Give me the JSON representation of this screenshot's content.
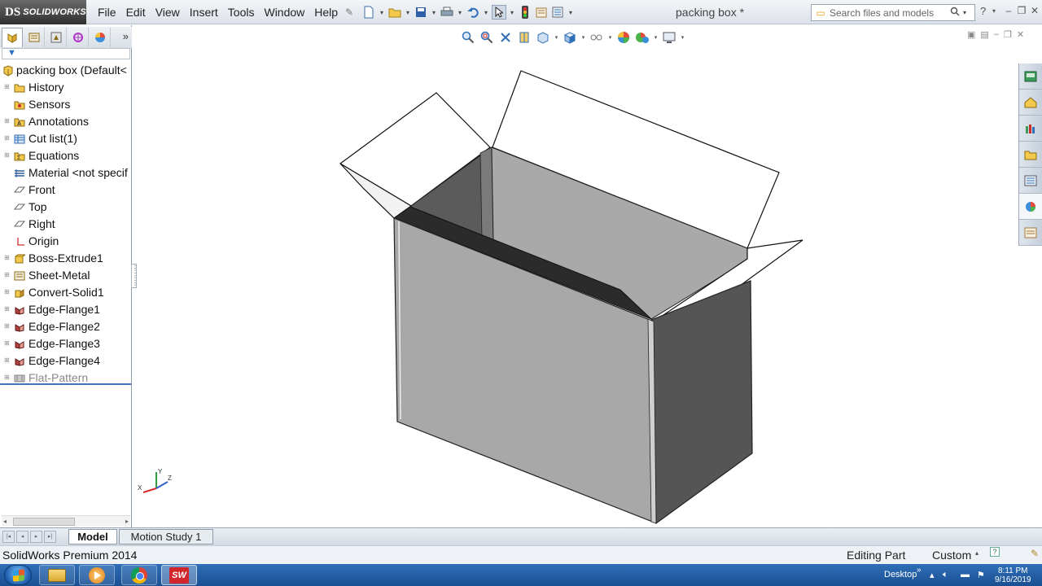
{
  "app": {
    "brand_mark": "DS",
    "brand_name": "SOLIDWORKS",
    "document_title": "packing box *",
    "menus": [
      {
        "label": "File"
      },
      {
        "label": "Edit"
      },
      {
        "label": "View"
      },
      {
        "label": "Insert"
      },
      {
        "label": "Tools"
      },
      {
        "label": "Window"
      },
      {
        "label": "Help"
      }
    ],
    "search": {
      "placeholder": "Search files and models",
      "value": ""
    },
    "colors": {
      "brand_bar": "#3a3a3a",
      "accent": "#3a78c2",
      "taskbar": "#1f5aa3",
      "solidworks_red": "#d2262c"
    }
  },
  "quick_access": [
    {
      "icon": "new-document-icon"
    },
    {
      "icon": "open-folder-icon"
    },
    {
      "icon": "save-icon"
    },
    {
      "icon": "print-icon"
    },
    {
      "icon": "undo-icon"
    },
    {
      "icon": "select-arrow-icon"
    },
    {
      "icon": "rebuild-traffic-light-icon"
    },
    {
      "icon": "file-properties-icon"
    },
    {
      "icon": "options-icon"
    }
  ],
  "view_toolbar": [
    "zoom-to-fit-icon",
    "zoom-to-area-icon",
    "previous-view-icon",
    "section-view-icon",
    "dynamic-annotation-icon",
    "view-orientation-icon",
    "display-style-icon",
    "hide-show-items-icon",
    "edit-appearance-icon",
    "apply-scene-icon",
    "view-settings-icon"
  ],
  "feature_tree": {
    "root": {
      "label": "packing box  (Default<"
    },
    "items": [
      {
        "label": "History",
        "icon": "history-folder-icon",
        "expandable": true
      },
      {
        "label": "Sensors",
        "icon": "sensor-icon",
        "expandable": false
      },
      {
        "label": "Annotations",
        "icon": "annotations-icon",
        "expandable": true
      },
      {
        "label": "Cut list(1)",
        "icon": "cut-list-icon",
        "expandable": true
      },
      {
        "label": "Equations",
        "icon": "equations-icon",
        "expandable": true
      },
      {
        "label": "Material <not specif",
        "icon": "material-icon",
        "expandable": false
      },
      {
        "label": "Front",
        "icon": "plane-icon",
        "expandable": false
      },
      {
        "label": "Top",
        "icon": "plane-icon",
        "expandable": false
      },
      {
        "label": "Right",
        "icon": "plane-icon",
        "expandable": false
      },
      {
        "label": "Origin",
        "icon": "origin-icon",
        "expandable": false
      },
      {
        "label": "Boss-Extrude1",
        "icon": "boss-extrude-icon",
        "expandable": true
      },
      {
        "label": "Sheet-Metal",
        "icon": "sheet-metal-icon",
        "expandable": true
      },
      {
        "label": "Convert-Solid1",
        "icon": "convert-solid-icon",
        "expandable": true
      },
      {
        "label": "Edge-Flange1",
        "icon": "edge-flange-icon",
        "expandable": true
      },
      {
        "label": "Edge-Flange2",
        "icon": "edge-flange-icon",
        "expandable": true
      },
      {
        "label": "Edge-Flange3",
        "icon": "edge-flange-icon",
        "expandable": true
      },
      {
        "label": "Edge-Flange4",
        "icon": "edge-flange-icon",
        "expandable": true
      },
      {
        "label": "Flat-Pattern",
        "icon": "flat-pattern-icon",
        "expandable": true,
        "suppressed": true
      }
    ]
  },
  "triad": {
    "x_label": "X",
    "y_label": "Y",
    "z_label": "Z"
  },
  "bottom_tabs": {
    "model": "Model",
    "motion": "Motion Study 1"
  },
  "status": {
    "product": "SolidWorks Premium 2014",
    "mode": "Editing Part",
    "units": "Custom",
    "help_glyph": "?"
  },
  "taskbar": {
    "desktop_label": "Desktop",
    "time": "8:11 PM",
    "date": "9/16/2019"
  }
}
